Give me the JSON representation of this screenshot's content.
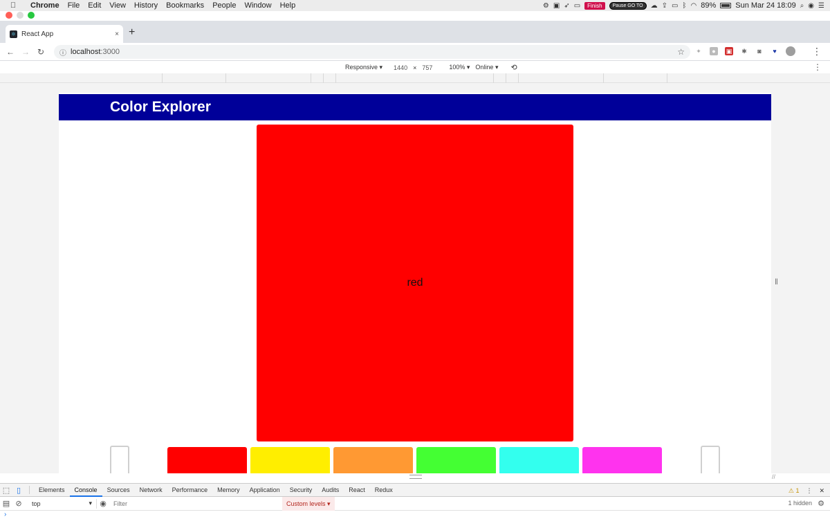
{
  "menubar": {
    "apple": "",
    "items": [
      "Chrome",
      "File",
      "Edit",
      "View",
      "History",
      "Bookmarks",
      "People",
      "Window",
      "Help"
    ],
    "finish_label": "Finish",
    "pause_label": "Pause GO TO",
    "battery": "89%",
    "battery_level": 0.89,
    "datetime": "Sun Mar 24  18:09"
  },
  "tab": {
    "title": "React App",
    "close": "×",
    "new_tab": "+"
  },
  "omnibox": {
    "host": "localhost",
    "port": ":3000"
  },
  "device_toolbar": {
    "mode": "Responsive ▾",
    "width": "1440",
    "times": "×",
    "height": "757",
    "zoom": "100% ▾",
    "network": "Online ▾"
  },
  "app": {
    "title": "Color Explorer",
    "selected": {
      "name": "red",
      "color": "#ff0000"
    },
    "swatches": [
      {
        "color": "#ff0000"
      },
      {
        "color": "#ffee00"
      },
      {
        "color": "#ff9933"
      },
      {
        "color": "#44ff33"
      },
      {
        "color": "#33ffee"
      },
      {
        "color": "#ff33ee"
      }
    ]
  },
  "devtools": {
    "tabs": [
      "Elements",
      "Console",
      "Sources",
      "Network",
      "Performance",
      "Memory",
      "Application",
      "Security",
      "Audits",
      "React",
      "Redux"
    ],
    "active_tab": "Console",
    "warnings": "⚠ 1",
    "context": "top",
    "filter_placeholder": "Filter",
    "levels": "Custom levels ▾",
    "hidden": "1 hidden",
    "prompt": "›"
  },
  "colors": {
    "header": "#000099",
    "accent": "#1a73e8"
  }
}
